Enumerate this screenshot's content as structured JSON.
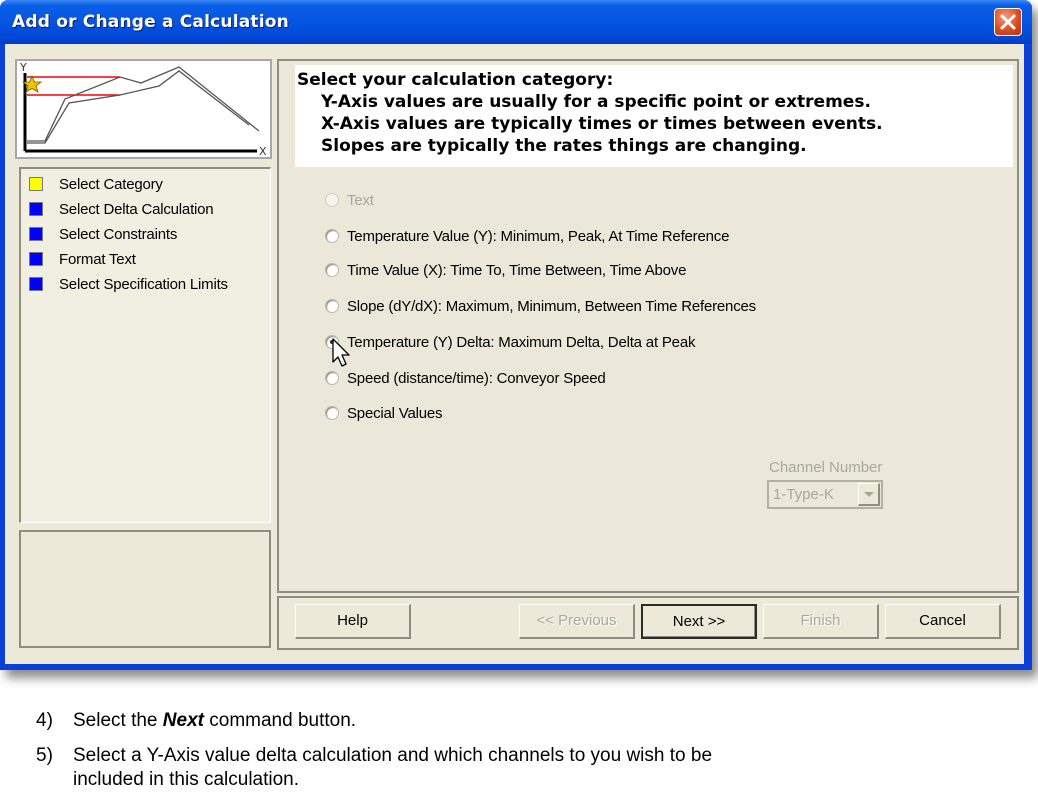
{
  "window": {
    "title": "Add or Change a Calculation",
    "close_icon": "close-icon"
  },
  "thumbnail": {
    "icon": "y-delta-graph-icon",
    "y_axis_label": "Y",
    "x_axis_label": "X",
    "marker": "star-icon"
  },
  "steps": [
    {
      "label": "Select Category",
      "color": "#ffff00",
      "state": "current"
    },
    {
      "label": "Select Delta Calculation",
      "color": "#0000ff",
      "state": "pending"
    },
    {
      "label": "Select Constraints",
      "color": "#0000ff",
      "state": "pending"
    },
    {
      "label": "Format Text",
      "color": "#0000ff",
      "state": "pending"
    },
    {
      "label": "Select Specification Limits",
      "color": "#0000ff",
      "state": "pending"
    }
  ],
  "header": {
    "title": "Select your calculation category:",
    "lines": [
      "Y-Axis values are usually for a specific point or extremes.",
      "X-Axis values are typically times or times between events.",
      "Slopes are typically the rates things are changing."
    ]
  },
  "categories": [
    {
      "label": "Text",
      "enabled": false,
      "selected": false
    },
    {
      "label": "Temperature Value (Y):  Minimum, Peak, At Time Reference",
      "enabled": true,
      "selected": false
    },
    {
      "label": "Time Value (X):  Time To, Time Between, Time Above",
      "enabled": true,
      "selected": false
    },
    {
      "label": "Slope (dY/dX):  Maximum, Minimum, Between Time References",
      "enabled": true,
      "selected": false
    },
    {
      "label": "Temperature (Y) Delta:  Maximum Delta, Delta at Peak",
      "enabled": true,
      "selected": true
    },
    {
      "label": "Speed (distance/time): Conveyor Speed",
      "enabled": true,
      "selected": false
    },
    {
      "label": "Special  Values",
      "enabled": true,
      "selected": false
    }
  ],
  "channel": {
    "label": "Channel Number",
    "value": "1-Type-K",
    "enabled": false
  },
  "buttons": {
    "help": "Help",
    "previous": "<< Previous",
    "next": "Next >>",
    "finish": "Finish",
    "cancel": "Cancel"
  },
  "instructions": [
    {
      "num": "4)",
      "pre": "Select the ",
      "em": "Next",
      "post": " command button."
    },
    {
      "num": "5)",
      "line1": "Select a Y-Axis value delta calculation and which channels to you wish to be",
      "line2": "included in this calculation."
    }
  ]
}
